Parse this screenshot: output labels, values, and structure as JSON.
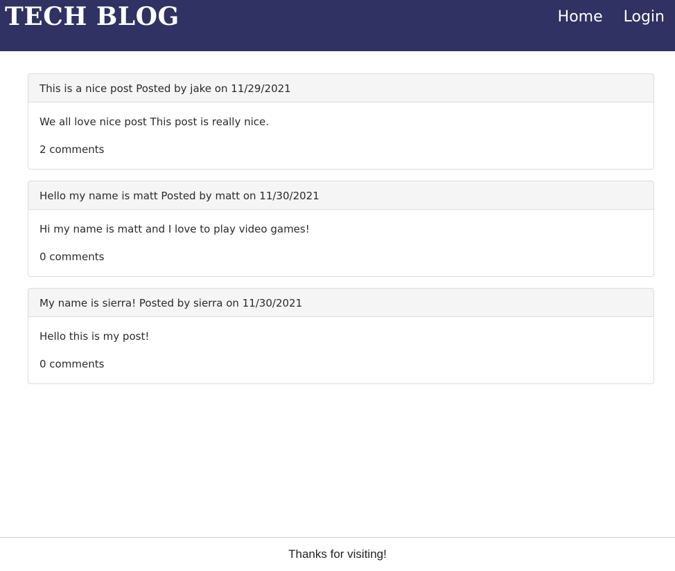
{
  "header": {
    "brand": "TECH BLOG",
    "nav": [
      {
        "label": "Home"
      },
      {
        "label": "Login"
      }
    ]
  },
  "posts": [
    {
      "title": "This is a nice post",
      "author": "jake",
      "date": "11/29/2021",
      "byline": "This is a nice post Posted by jake on 11/29/2021",
      "body": "We all love nice post This post is really nice.",
      "comments": "2 comments"
    },
    {
      "title": "Hello my name is matt",
      "author": "matt",
      "date": "11/30/2021",
      "byline": "Hello my name is matt Posted by matt on 11/30/2021",
      "body": "Hi my name is matt and I love to play video games!",
      "comments": "0 comments"
    },
    {
      "title": "My name is sierra!",
      "author": "sierra",
      "date": "11/30/2021",
      "byline": "My name is sierra! Posted by sierra on 11/30/2021",
      "body": "Hello this is my post!",
      "comments": "0 comments"
    }
  ],
  "footer": {
    "text": "Thanks for visiting!"
  },
  "colors": {
    "header_bg": "#2f3262",
    "card_header_bg": "#f5f5f5",
    "border": "#dcdcdc"
  }
}
